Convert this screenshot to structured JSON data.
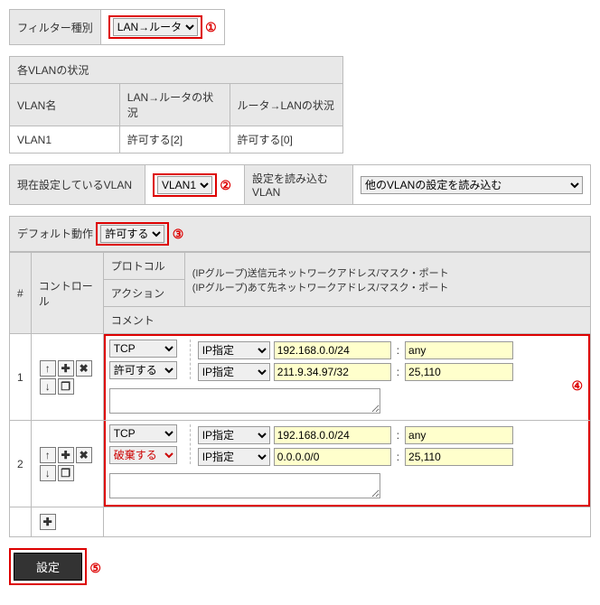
{
  "filterType": {
    "label": "フィルター種別",
    "value": "LAN→ルータ"
  },
  "markers": {
    "m1": "①",
    "m2": "②",
    "m3": "③",
    "m4": "④",
    "m5": "⑤"
  },
  "vlanStatus": {
    "title": "各VLANの状況",
    "headers": [
      "VLAN名",
      "LAN→ルータの状況",
      "ルータ→LANの状況"
    ],
    "rows": [
      [
        "VLAN1",
        "許可する[2]",
        "許可する[0]"
      ]
    ]
  },
  "settingBar": {
    "currentLabel": "現在設定しているVLAN",
    "currentValue": "VLAN1",
    "loadLabel": "設定を読み込むVLAN",
    "loadValue": "他のVLANの設定を読み込む"
  },
  "defaultAction": {
    "label": "デフォルト動作",
    "value": "許可する"
  },
  "ruleHeaders": {
    "num": "#",
    "control": "コントロール",
    "protocol": "プロトコル",
    "src": "(IPグループ)送信元ネットワークアドレス/マスク・ポート",
    "dst": "(IPグループ)あて先ネットワークアドレス/マスク・ポート",
    "action": "アクション",
    "comment": "コメント"
  },
  "ctrlIcons": {
    "up": "↑",
    "add": "✚",
    "del": "✖",
    "down": "↓",
    "copy": "❐"
  },
  "rules": [
    {
      "num": "1",
      "protocol": "TCP",
      "action": "許可する",
      "srcType": "IP指定",
      "srcIp": "192.168.0.0/24",
      "srcPort": "any",
      "dstType": "IP指定",
      "dstIp": "211.9.34.97/32",
      "dstPort": "25,110",
      "comment": ""
    },
    {
      "num": "2",
      "protocol": "TCP",
      "action": "破棄する",
      "srcType": "IP指定",
      "srcIp": "192.168.0.0/24",
      "srcPort": "any",
      "dstType": "IP指定",
      "dstIp": "0.0.0.0/0",
      "dstPort": "25,110",
      "comment": ""
    }
  ],
  "btnSet": "設定"
}
